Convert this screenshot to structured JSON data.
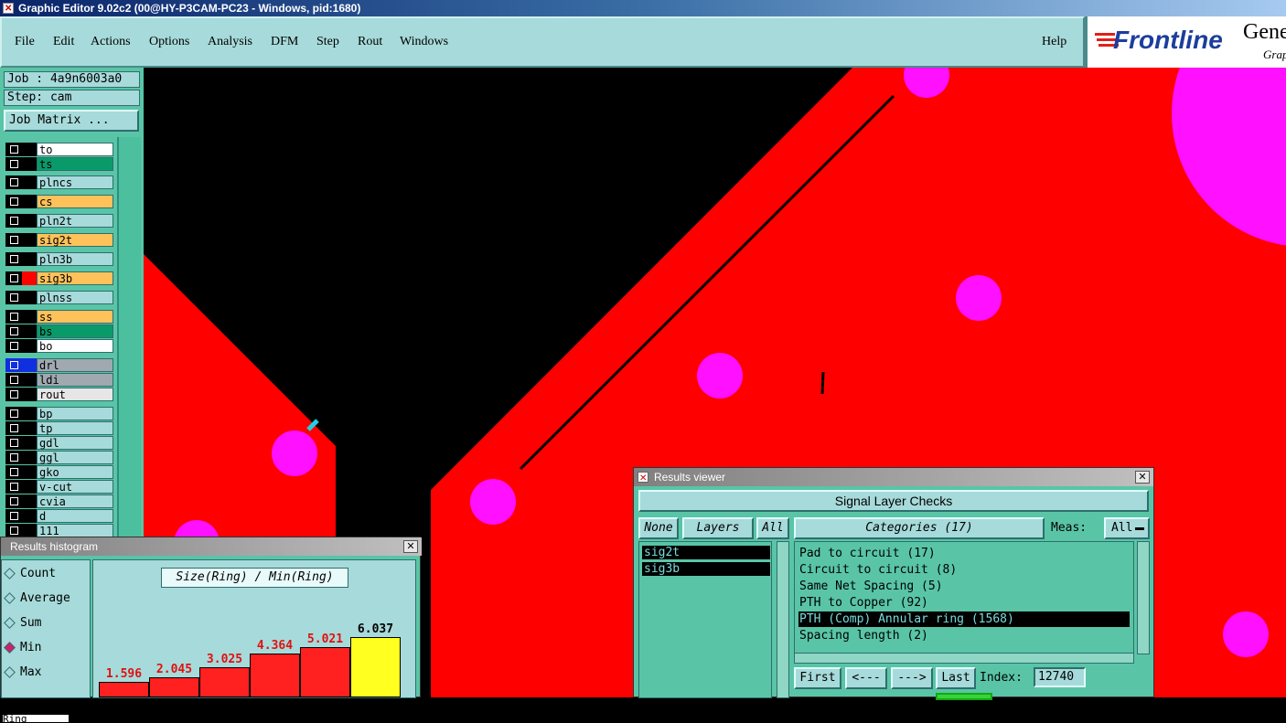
{
  "window": {
    "title": "Graphic Editor 9.02c2 (00@HY-P3CAM-PC23 - Windows, pid:1680)"
  },
  "menu": {
    "items": [
      "File",
      "Edit",
      "Actions",
      "Options",
      "Analysis",
      "DFM",
      "Step",
      "Rout",
      "Windows"
    ],
    "help": "Help"
  },
  "logo": {
    "brand": "Frontline",
    "gene": "Gene",
    "graph": "Grap"
  },
  "left": {
    "job": "Job : 4a9n6003a0",
    "step": "Step: cam",
    "job_matrix": "Job Matrix ..."
  },
  "layers": [
    {
      "name": "to",
      "bg": "#ffffff",
      "swatch": "#000000"
    },
    {
      "name": "ts",
      "bg": "#0a9a6a",
      "swatch": "#000000"
    },
    {
      "name": "plncs",
      "bg": "#a7dada",
      "swatch": "#000000"
    },
    {
      "name": "cs",
      "bg": "#ffc25a",
      "swatch": "#000000"
    },
    {
      "name": "pln2t",
      "bg": "#a7dada",
      "swatch": "#000000"
    },
    {
      "name": "sig2t",
      "bg": "#ffc25a",
      "swatch": "#000000"
    },
    {
      "name": "pln3b",
      "bg": "#a7dada",
      "swatch": "#000000"
    },
    {
      "name": "sig3b",
      "bg": "#ffc25a",
      "swatch": "#ff0000"
    },
    {
      "name": "plnss",
      "bg": "#a7dada",
      "swatch": "#000000"
    },
    {
      "name": "ss",
      "bg": "#ffc25a",
      "swatch": "#000000"
    },
    {
      "name": "bs",
      "bg": "#0a9a6a",
      "swatch": "#000000"
    },
    {
      "name": "bo",
      "bg": "#ffffff",
      "swatch": "#000000"
    },
    {
      "name": "drl",
      "bg": "#a0a8b0",
      "swatch": "#1030e0"
    },
    {
      "name": "ldi",
      "bg": "#a0a8b0",
      "swatch": "#000000"
    },
    {
      "name": "rout",
      "bg": "#e6e6e6",
      "swatch": "#000000"
    },
    {
      "name": "bp",
      "bg": "#a7dada",
      "swatch": "#000000"
    },
    {
      "name": "tp",
      "bg": "#a7dada",
      "swatch": "#000000"
    },
    {
      "name": "gdl",
      "bg": "#a7dada",
      "swatch": "#000000"
    },
    {
      "name": "ggl",
      "bg": "#a7dada",
      "swatch": "#000000"
    },
    {
      "name": "gko",
      "bg": "#a7dada",
      "swatch": "#000000"
    },
    {
      "name": "v-cut",
      "bg": "#a7dada",
      "swatch": "#000000"
    },
    {
      "name": "cvia",
      "bg": "#a7dada",
      "swatch": "#000000"
    },
    {
      "name": "d",
      "bg": "#a7dada",
      "swatch": "#000000"
    },
    {
      "name": "111",
      "bg": "#a7dada",
      "swatch": "#000000"
    }
  ],
  "histogram": {
    "title": "Results histogram",
    "close": "✕",
    "options": [
      "Count",
      "Average",
      "Sum",
      "Min",
      "Max"
    ],
    "selected": "Min",
    "heading": "Size(Ring) / Min(Ring)",
    "ring_field": "Ring",
    "bars": [
      {
        "value": 1.596,
        "label": "1.596",
        "color": "#ff2020"
      },
      {
        "value": 2.045,
        "label": "2.045",
        "color": "#ff2020"
      },
      {
        "value": 3.025,
        "label": "3.025",
        "color": "#ff2020"
      },
      {
        "value": 4.364,
        "label": "4.364",
        "color": "#ff2020"
      },
      {
        "value": 5.021,
        "label": "5.021",
        "color": "#ff2020"
      },
      {
        "value": 6.037,
        "label": "6.037",
        "color": "#ffff20"
      }
    ]
  },
  "results_viewer": {
    "title": "Results viewer",
    "close": "✕",
    "check_name": "Signal Layer Checks",
    "none_btn": "None",
    "layers_btn": "Layers",
    "all_btn": "All",
    "categories_btn": "Categories (17)",
    "meas_label": "Meas:",
    "meas_value": "All",
    "layers": [
      "sig2t",
      "sig3b"
    ],
    "categories": [
      "Pad to circuit (17)",
      "Circuit to circuit (8)",
      "Same Net Spacing (5)",
      "PTH to Copper (92)",
      "PTH (Comp) Annular ring (1568)",
      "Spacing length (2)"
    ],
    "selected_category": "PTH (Comp) Annular ring (1568)",
    "nav": {
      "first": "First",
      "prev": "<---",
      "next": "--->",
      "last": "Last"
    },
    "index_label": "Index:",
    "index_value": "12740"
  },
  "colors": {
    "panel": "#a7dada",
    "panel_dark": "#59c5a6",
    "copper": "#ff0000",
    "pad": "#ff10ff",
    "background": "#000000"
  }
}
